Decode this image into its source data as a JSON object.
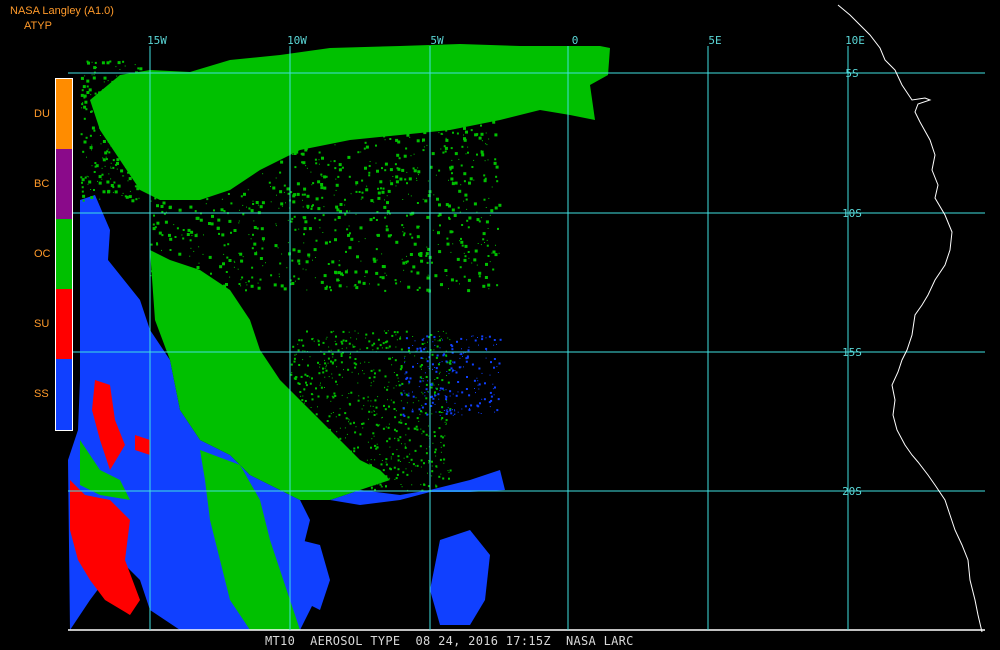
{
  "header": {
    "producer": "NASA Langley (A1.0)",
    "product": "ATYP"
  },
  "legend": [
    {
      "code": "DU",
      "color": "#ff8c00"
    },
    {
      "code": "BC",
      "color": "#8a0a8a"
    },
    {
      "code": "OC",
      "color": "#00c000"
    },
    {
      "code": "SU",
      "color": "#ff0000"
    },
    {
      "code": "SS",
      "color": "#1040ff"
    }
  ],
  "map": {
    "lon_labels": [
      "15W",
      "10W",
      "5W",
      "0",
      "5E",
      "10E"
    ],
    "lat_labels": [
      "5S",
      "10S",
      "15S",
      "20S"
    ],
    "grid_color": "#40e0e0",
    "coast_color": "#ffffff"
  },
  "footer": "MT10  AEROSOL TYPE  08 24, 2016 17:15Z  NASA LARC"
}
